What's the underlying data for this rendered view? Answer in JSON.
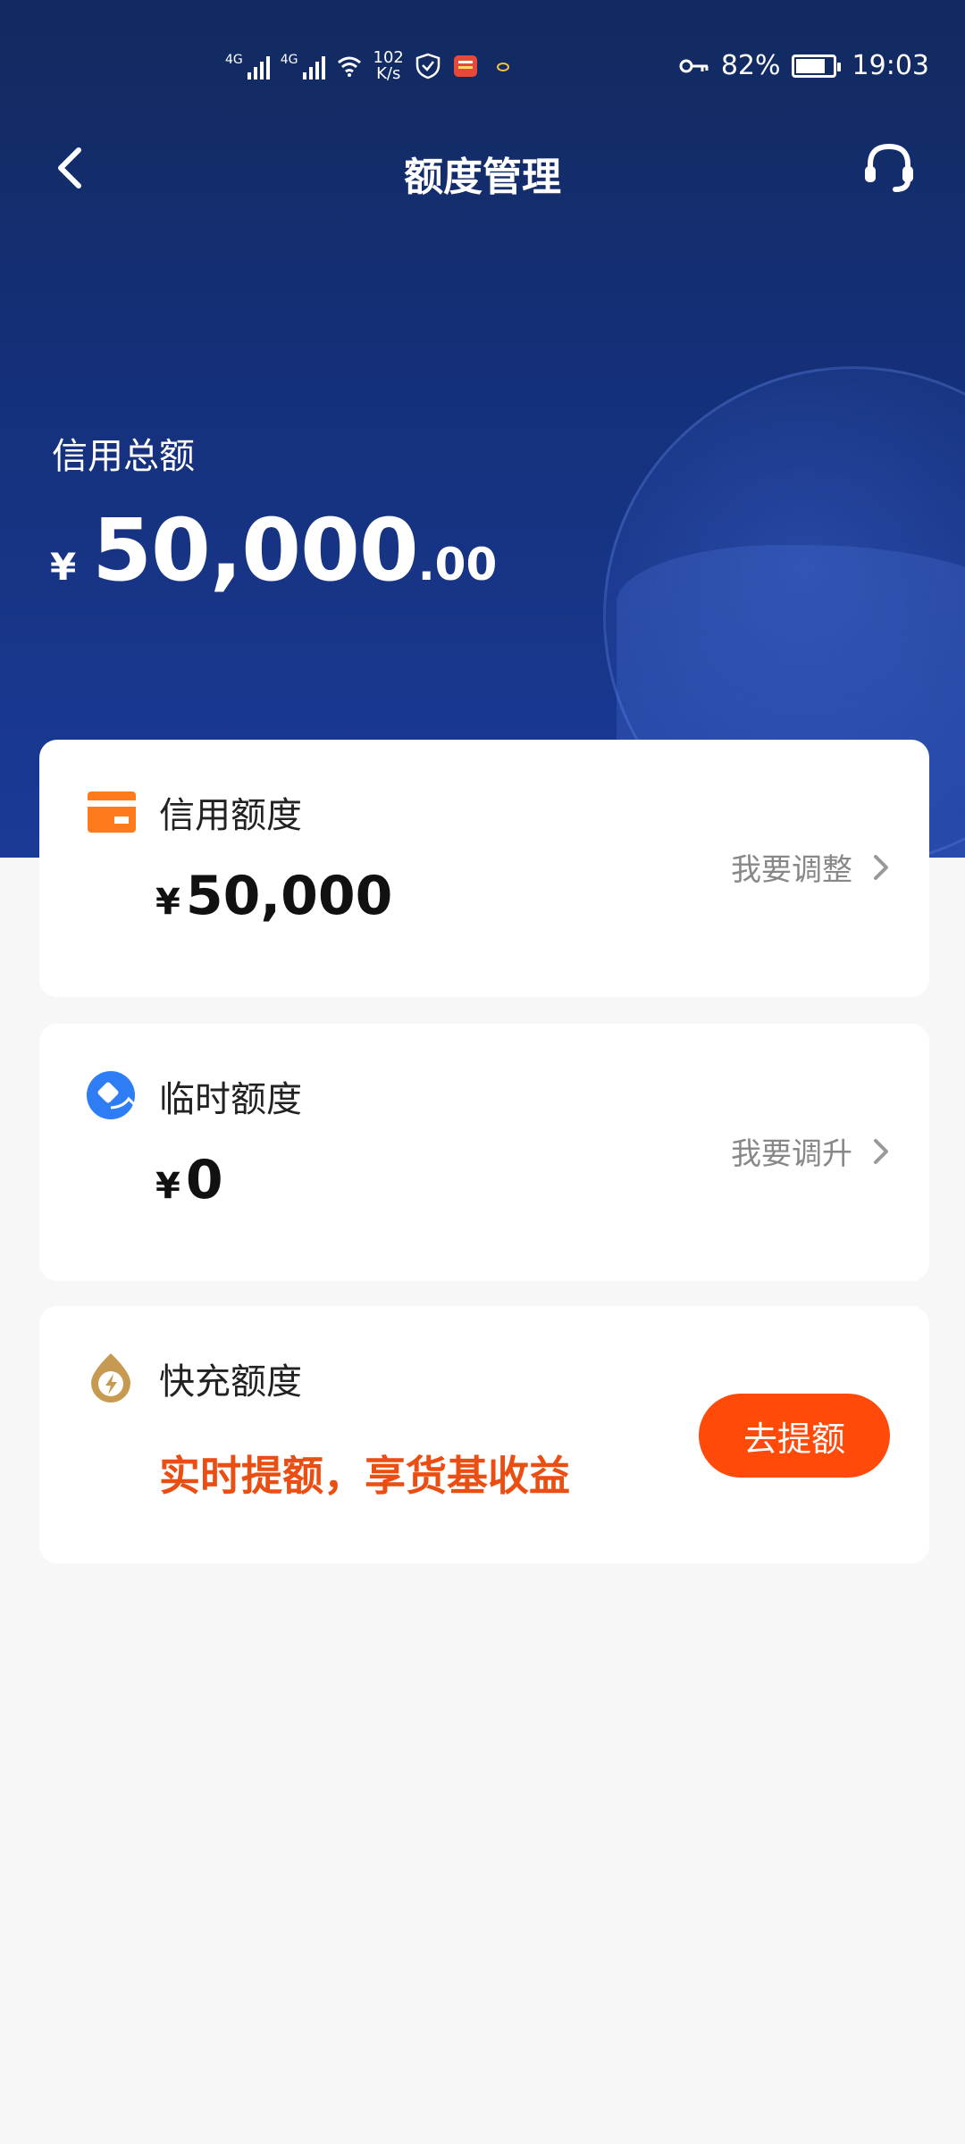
{
  "status_bar": {
    "signal1_label": "4G",
    "signal2_label": "4G",
    "net_speed_value": "102",
    "net_speed_unit": "K/s",
    "battery_percent": "82%",
    "battery_level": 0.82,
    "time": "19:03"
  },
  "nav": {
    "title": "额度管理"
  },
  "total": {
    "label": "信用总额",
    "currency": "¥",
    "integer": "50,000",
    "decimal": ".00"
  },
  "cards": [
    {
      "title": "信用额度",
      "currency": "¥",
      "value": "50,000",
      "action": "我要调整",
      "icon": "card-icon"
    },
    {
      "title": "临时额度",
      "currency": "¥",
      "value": "0",
      "action": "我要调升",
      "icon": "temp-credit-icon"
    },
    {
      "title": "快充额度",
      "promo": "实时提额，享货基收益",
      "button": "去提额",
      "icon": "lightning-drop-icon"
    }
  ],
  "colors": {
    "header_bg": "#15307a",
    "accent_orange": "#ff4a0a",
    "promo_text": "#ea4e12",
    "page_bg": "#f7f7f7"
  }
}
